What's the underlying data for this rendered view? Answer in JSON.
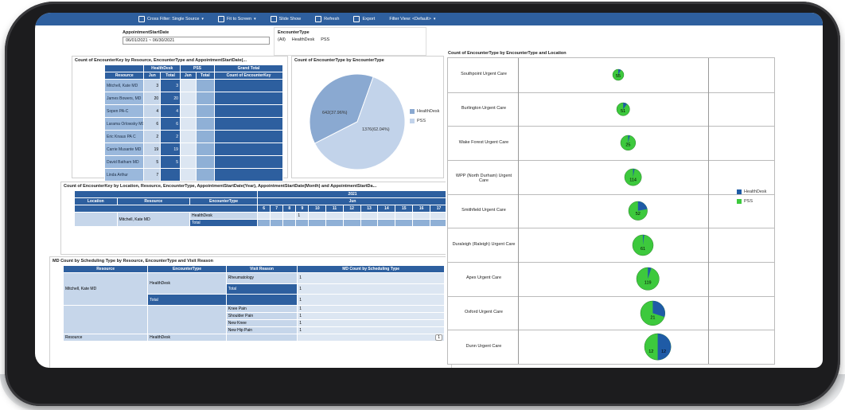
{
  "toolbar": {
    "items": [
      {
        "label": "Cross Filter: Single Source",
        "icon": "filter-icon"
      },
      {
        "label": "Fit to Screen",
        "icon": "fit-icon"
      },
      {
        "label": "Slide Show",
        "icon": "slideshow-icon"
      },
      {
        "label": "Refresh",
        "icon": "refresh-icon"
      },
      {
        "label": "Export",
        "icon": "export-icon"
      },
      {
        "label": "Filter View: <Default>",
        "icon": ""
      }
    ]
  },
  "filters": {
    "date": {
      "label": "AppointmentStartDate",
      "value": "06/01/2021 ~ 06/30/2021"
    },
    "encounter": {
      "label": "EncounterType",
      "options": [
        "(All)",
        "HealthDesk",
        "PSS"
      ]
    }
  },
  "resource_table": {
    "title": "Count of EncounterKey by Resource, EncounterType and AppointmentStartDate(...",
    "groups": [
      "HealthDesk",
      "PSS",
      "Grand Total"
    ],
    "headers": [
      "Resource",
      "Jun",
      "Total",
      "Jun",
      "Total",
      "Count of EncounterKey"
    ],
    "rows": [
      {
        "name": "Mitchell, Kate MD",
        "v": [
          "3",
          "3",
          "",
          "",
          ""
        ]
      },
      {
        "name": "James Bowers, MD",
        "v": [
          "20",
          "20",
          "",
          "",
          ""
        ]
      },
      {
        "name": "Sopen PA-C",
        "v": [
          "4",
          "4",
          "",
          "",
          ""
        ]
      },
      {
        "name": "Larama Orlowsky MD",
        "v": [
          "6",
          "6",
          "",
          "",
          ""
        ]
      },
      {
        "name": "Eric Knaus PA C",
        "v": [
          "2",
          "2",
          "",
          "",
          ""
        ]
      },
      {
        "name": "Carrie Musante MD",
        "v": [
          "19",
          "19",
          "",
          "",
          ""
        ]
      },
      {
        "name": "David Batham MD",
        "v": [
          "5",
          "5",
          "",
          "",
          ""
        ]
      },
      {
        "name": "Linda Arthur",
        "v": [
          "7",
          "",
          "",
          "",
          ""
        ]
      }
    ]
  },
  "pie": {
    "title": "Count of EncounterType by EncounterType",
    "legend": [
      "HealthDesk",
      "PSS"
    ],
    "labels": [
      "642(37.96%)",
      "1376(62.04%)"
    ],
    "colors": {
      "HealthDesk": "#8aa9d1",
      "PSS": "#c2d3ea"
    }
  },
  "location_table": {
    "title": "Count of EncounterKey by Location, Resource, EncounterType, AppointmentStartDate(Year), AppointmentStartDate(Month) and AppointmentStartDa...",
    "year": "2021",
    "month": "Jun",
    "headers": [
      "Location",
      "Resource",
      "EncounterType"
    ],
    "days": [
      "6",
      "7",
      "8",
      "9",
      "10",
      "11",
      "12",
      "13",
      "14",
      "15",
      "16",
      "17"
    ],
    "resource": "Mitchell, Kate MD",
    "encounter": "HealthDesk",
    "value": "1",
    "total_label": "Total"
  },
  "md_table": {
    "title": "MD Count by Scheduling Type by Resource, EncounterType and Visit Reason",
    "headers": [
      "Resource",
      "EncounterType",
      "Visit Reason",
      "MD Count by Scheduling Type"
    ],
    "resource": "Mitchell, Kate MD",
    "encounter": "HealthDesk",
    "total_label": "Total",
    "rows": [
      {
        "reason": "Rheumatology",
        "count": "1"
      },
      {
        "reason": "Total",
        "count": "1"
      },
      {
        "reason": "",
        "count": "1"
      },
      {
        "reason": "Knee Pain",
        "count": "1"
      },
      {
        "reason": "Shoulder Pain",
        "count": "1"
      },
      {
        "reason": "New Knee",
        "count": "1"
      },
      {
        "reason": "New Hip Pain",
        "count": "1"
      }
    ],
    "footer_resource": "Resource",
    "footer_encounter": "HealthDesk",
    "page_indicator": "1"
  },
  "location_chart": {
    "title": "Count of EncounterType by EncounterType and Location",
    "legend": [
      "HealthDesk",
      "PSS"
    ],
    "colors": {
      "HealthDesk": "#1f5ba6",
      "PSS": "#3dc93d"
    },
    "rows": [
      {
        "location": "Southpoint Urgent Care",
        "pss": "55",
        "hd_frac": 0.08
      },
      {
        "location": "Burlington Urgent Care",
        "pss": "51",
        "hd_frac": 0.1
      },
      {
        "location": "Wake Forest Urgent Care",
        "pss": "25",
        "hd_frac": 0.04
      },
      {
        "location": "WPP (North Durham) Urgent Care",
        "pss": "114",
        "hd_frac": 0.03
      },
      {
        "location": "Smithfield Urgent Care",
        "pss": "52",
        "hd_frac": 0.22
      },
      {
        "location": "Duraleigh (Raleigh) Urgent Care",
        "pss": "61",
        "hd_frac": 0.02
      },
      {
        "location": "Apex Urgent Care",
        "pss": "119",
        "hd_frac": 0.05
      },
      {
        "location": "Oxford Urgent Care",
        "pss": "21",
        "hd_frac": 0.3
      },
      {
        "location": "Dunn Urgent Care",
        "pss": "12",
        "hd": "12",
        "hd_frac": 0.5
      }
    ]
  }
}
